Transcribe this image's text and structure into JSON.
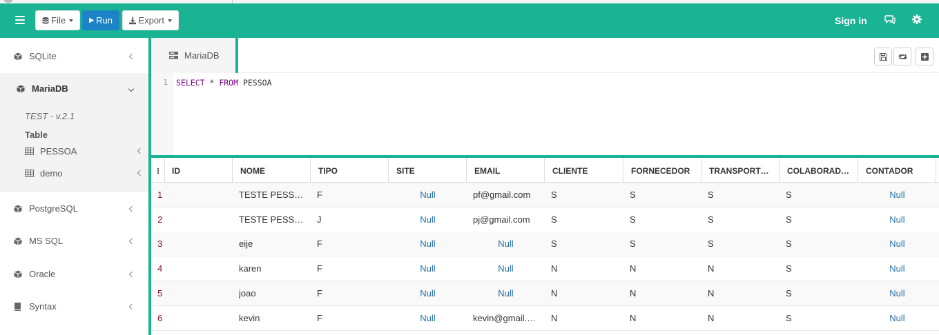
{
  "navbar": {
    "file_label": "File",
    "run_label": "Run",
    "export_label": "Export",
    "signin_label": "Sign in"
  },
  "sidebar": {
    "items": [
      {
        "label": "SQLite"
      },
      {
        "label": "MariaDB"
      },
      {
        "label": "PostgreSQL"
      },
      {
        "label": "MS SQL"
      },
      {
        "label": "Oracle"
      },
      {
        "label": "Syntax"
      }
    ],
    "mariadb": {
      "version": "TEST - v.2.1",
      "table_heading": "Table",
      "tables": [
        "PESSOA",
        "demo"
      ]
    }
  },
  "editor": {
    "tab_label": "MariaDB",
    "line_number": "1",
    "kw_select": "SELECT",
    "star": " * ",
    "kw_from": "FROM",
    "table": " PESSOA"
  },
  "grid": {
    "columns": [
      "ID",
      "NOME",
      "TIPO",
      "SITE",
      "EMAIL",
      "CLIENTE",
      "FORNECEDOR",
      "TRANSPORT…",
      "COLABORAD…",
      "CONTADOR"
    ],
    "rows": [
      [
        "1",
        "TESTE PESSO…",
        "F",
        "Null",
        "pf@gmail.com",
        "S",
        "S",
        "S",
        "S",
        "Null"
      ],
      [
        "2",
        "TESTE PESSO…",
        "J",
        "Null",
        "pj@gmail.com",
        "S",
        "S",
        "S",
        "S",
        "Null"
      ],
      [
        "3",
        "eije",
        "F",
        "Null",
        "Null",
        "S",
        "S",
        "S",
        "S",
        "Null"
      ],
      [
        "4",
        "karen",
        "F",
        "Null",
        "Null",
        "N",
        "N",
        "N",
        "S",
        "Null"
      ],
      [
        "5",
        "joao",
        "F",
        "Null",
        "Null",
        "N",
        "N",
        "N",
        "S",
        "Null"
      ],
      [
        "6",
        "kevin",
        "F",
        "Null",
        "kevin@gmail.c…",
        "N",
        "N",
        "N",
        "S",
        "Null"
      ]
    ]
  },
  "colors": {
    "accent": "#1ab394",
    "run_button": "#1c84c6",
    "null_text": "#2a6faa",
    "id_text": "#8a1538"
  }
}
